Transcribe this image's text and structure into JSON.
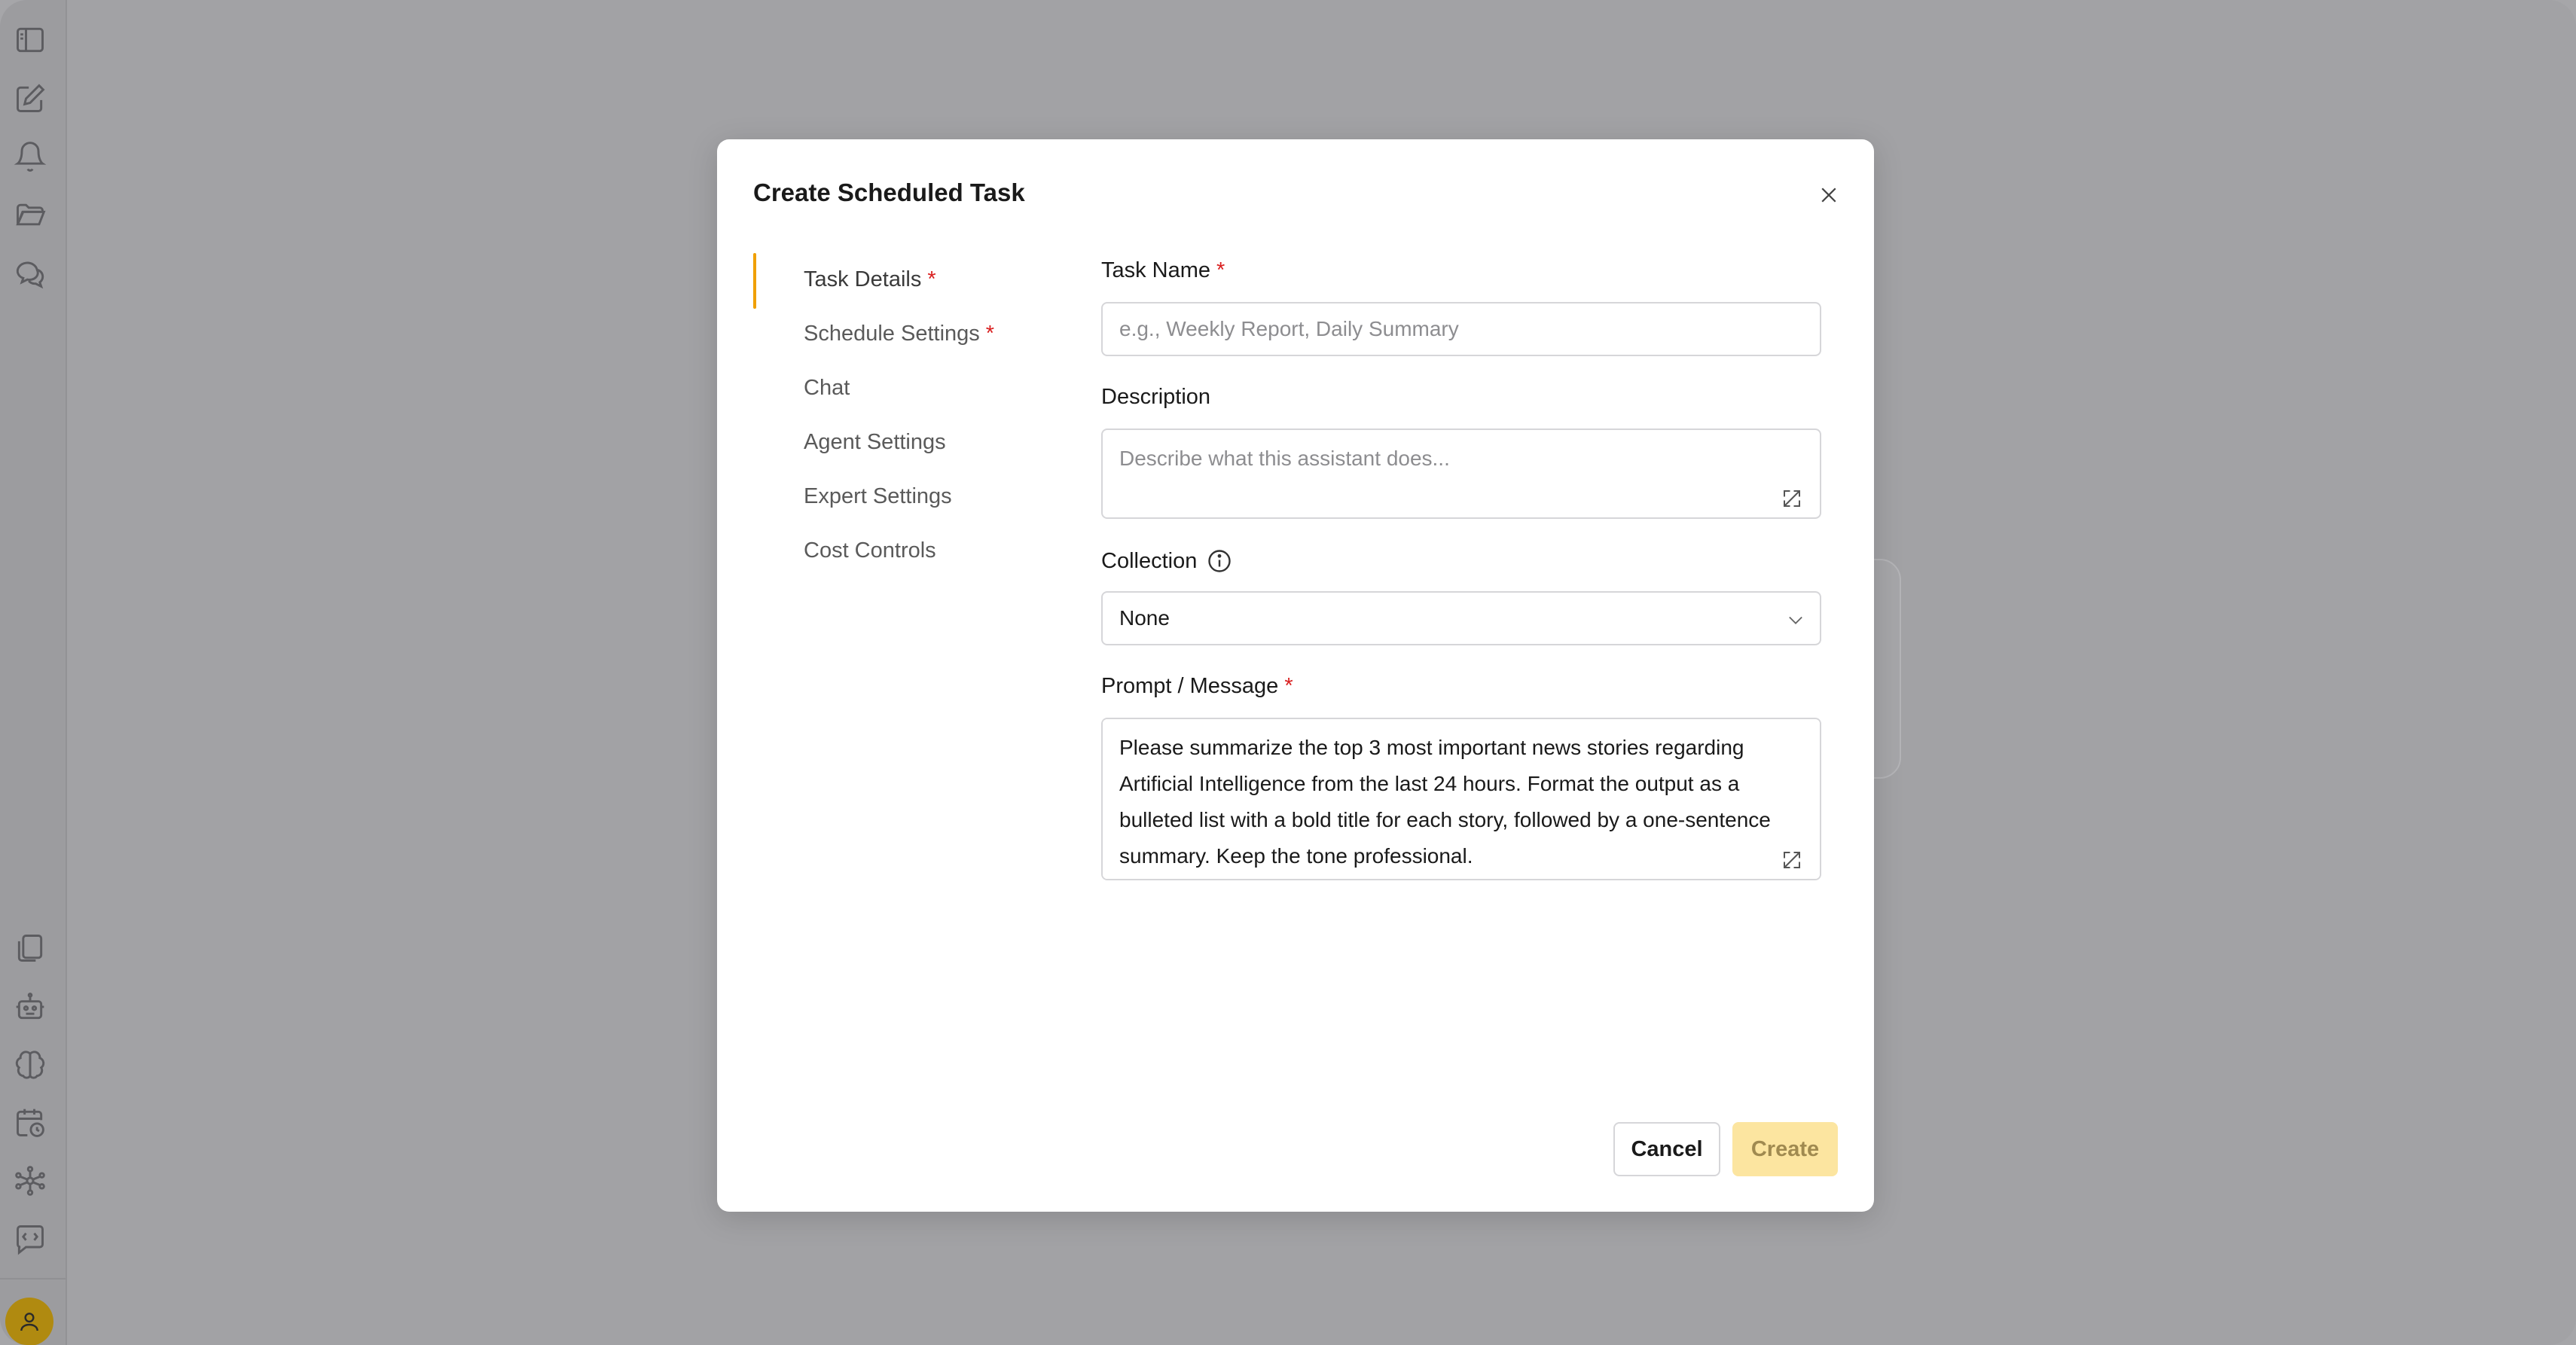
{
  "sidebar": {
    "top_icons": [
      "sidebar-toggle-icon",
      "new-chat-icon",
      "notifications-bell-icon",
      "folder-icon",
      "chats-icon"
    ],
    "bottom_icons": [
      "documents-icon",
      "robot-icon",
      "brain-icon",
      "scheduled-calendar-icon",
      "workflow-network-icon",
      "code-chat-icon"
    ],
    "avatar_icon": "user-icon"
  },
  "modal": {
    "title": "Create Scheduled Task",
    "close_icon": "close-icon",
    "nav": {
      "items": [
        {
          "label": "Task Details",
          "required": "*"
        },
        {
          "label": "Schedule Settings",
          "required": "*"
        },
        {
          "label": "Chat"
        },
        {
          "label": "Agent Settings"
        },
        {
          "label": "Expert Settings"
        },
        {
          "label": "Cost Controls"
        }
      ],
      "active_index": 0
    },
    "form": {
      "task_name": {
        "label": "Task Name",
        "required": "*",
        "value": "",
        "placeholder": "e.g., Weekly Report, Daily Summary"
      },
      "description": {
        "label": "Description",
        "value": "",
        "placeholder": "Describe what this assistant does..."
      },
      "collection": {
        "label": "Collection",
        "selected": "None"
      },
      "prompt": {
        "label": "Prompt / Message",
        "required": "*",
        "value": "Please summarize the top 3 most important news stories regarding Artificial Intelligence from the last 24 hours. Format the output as a bulleted list with a bold title for each story, followed by a one-sentence summary. Keep the tone professional."
      }
    },
    "buttons": {
      "cancel": "Cancel",
      "create": "Create"
    }
  },
  "colors": {
    "accent": "#f0a000",
    "required": "#d92020",
    "create_disabled_bg": "#fce5a0",
    "overlay": "#a2a2a5"
  }
}
